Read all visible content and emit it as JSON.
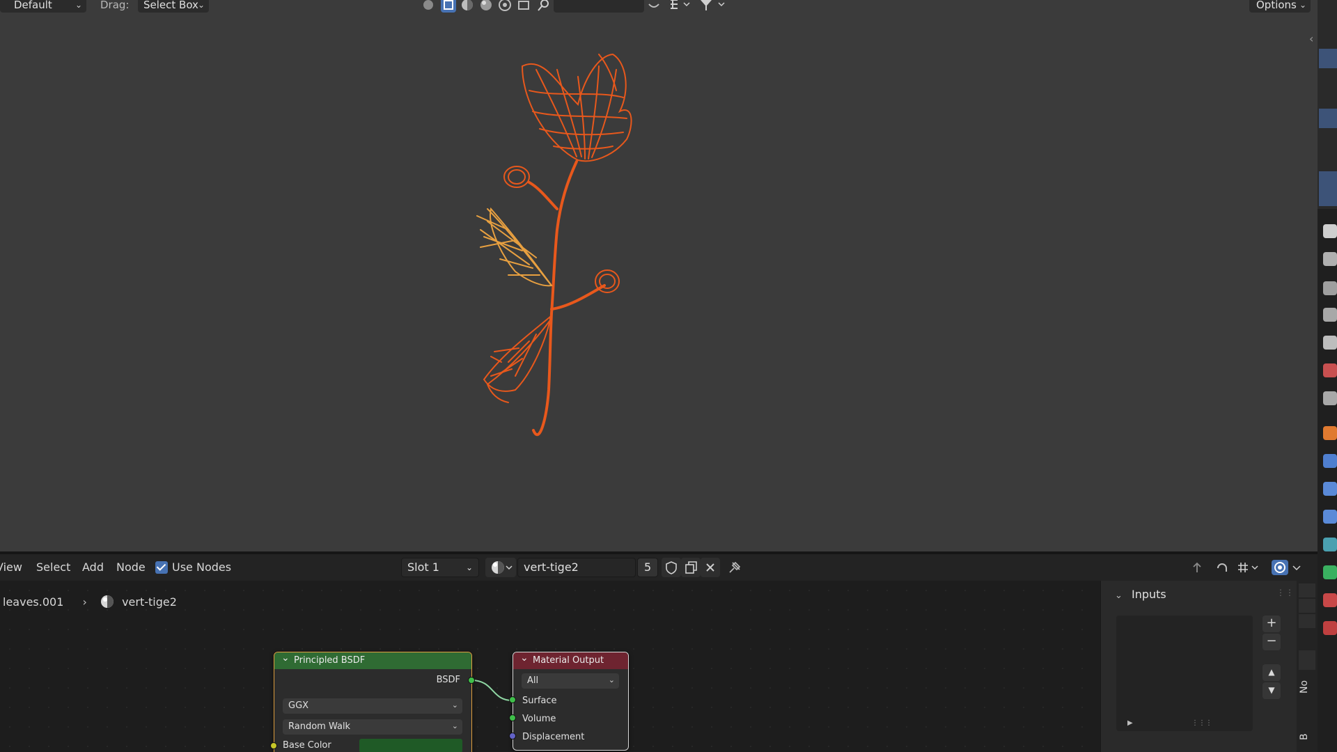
{
  "viewport_header": {
    "mode_label": "Default",
    "drag_label": "Drag:",
    "drag_value": "Select Box",
    "options_label": "Options"
  },
  "node_header": {
    "menu": [
      "View",
      "Select",
      "Add",
      "Node"
    ],
    "use_nodes_label": "Use Nodes",
    "use_nodes_checked": true,
    "slot_label": "Slot 1",
    "material_name": "vert-tige2",
    "user_count": "5"
  },
  "breadcrumb": {
    "object": "leaves.001",
    "material": "vert-tige2"
  },
  "nodes": {
    "principled": {
      "title": "Principled BSDF",
      "output": "BSDF",
      "distribution": "GGX",
      "subsurface": "Random Walk",
      "base_color_label": "Base Color",
      "header_color": "#2f6b33",
      "base_color": "#1f5a26"
    },
    "material_output": {
      "title": "Material Output",
      "target": "All",
      "inputs": [
        "Surface",
        "Volume",
        "Displacement"
      ],
      "header_color": "#6e2430"
    }
  },
  "sidebar": {
    "panel_title": "Inputs",
    "tabs": [
      "No",
      "B"
    ]
  },
  "colors": {
    "wireframe": "#e8581c",
    "wireframe_leaf": "#e8a040",
    "socket_shader": "#3fbf4a",
    "socket_vector": "#6363c7",
    "socket_color": "#c7c729",
    "accent": "#4772b3"
  }
}
